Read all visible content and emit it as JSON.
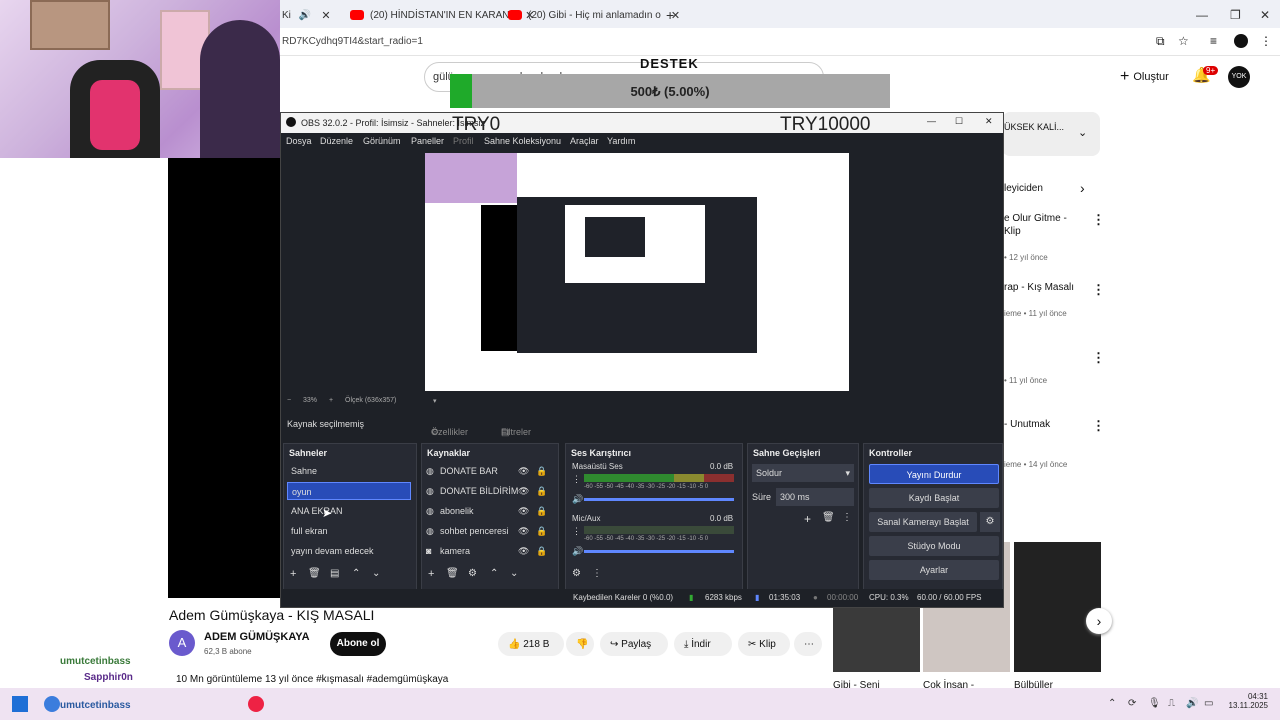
{
  "browser": {
    "tabs": [
      {
        "label": "Ki"
      },
      {
        "label": "(20) HİNDİSTAN'IN EN KARANL"
      },
      {
        "label": "(20) Gibi - Hiç mi anlamadın o"
      }
    ],
    "url": "RD7KCydhq9TI4&start_radio=1"
  },
  "youtube": {
    "search_value": "gülü ouyun ser askım bırakman",
    "create_label": "Oluştur",
    "notif_count": "9+",
    "avatar_text": "YOK",
    "chip_label": "ÜKSEK KALİ...",
    "related": [
      {
        "title": "leyiciden",
        "sub": ""
      },
      {
        "title": "e Olur Gitme -\nKlip",
        "sub": "• 12 yıl önce"
      },
      {
        "title": "rap - Kış Masalı",
        "sub": "ieme • 11 yıl önce"
      },
      {
        "title": "",
        "sub": "• 11 yıl önce"
      },
      {
        "title": "- Unutmak",
        "sub": "ieme • 14 yıl önce"
      }
    ],
    "shorts": [
      "Gibi - Seni",
      "Çok İnsan -",
      "Bülbüller"
    ],
    "video_title": "Adem Gümüşkaya - KIŞ MASALI",
    "channel_name": "ADEM GÜMÜŞKAYA",
    "channel_subs": "62,3 B abone",
    "channel_initial": "A",
    "subscribe_label": "Abone ol",
    "likes": "218 B",
    "share": "Paylaş",
    "download": "İndir",
    "clip": "Klip",
    "views_line": "10 Mn görüntüleme  13 yıl önce  #kışmasalı #ademgümüşkaya"
  },
  "overlay": {
    "destek": "DESTEK",
    "donate_amount": "500₺ (5.00%)",
    "donate_progress": 0.05,
    "min_label": "TRY0",
    "max_label": "TRY10000"
  },
  "chat": {
    "user1": "umutcetinbass",
    "user2": "Sapphir0n",
    "user3": "umutcetinbass"
  },
  "obs": {
    "title": "OBS 32.0.2 - Profil: İsimsiz - Sahneler: İsimsiz",
    "menu": [
      "Dosya",
      "Düzenle",
      "Görünüm",
      "Paneller",
      "Profil",
      "Sahne Koleksiyonu",
      "Araçlar",
      "Yardım"
    ],
    "zoom": "33%",
    "scale": "Ölçek (636x357)",
    "source_status": "Kaynak seçilmemiş",
    "properties": "Özellikler",
    "filters": "Filtreler",
    "scenes_title": "Sahneler",
    "scenes": [
      "Sahne",
      "oyun",
      "ANA EKRAN",
      "full ekran",
      "yayın devam edecek"
    ],
    "sources_title": "Kaynaklar",
    "sources": [
      "DONATE BAR",
      "DONATE BİLDİRİM",
      "abonelik",
      "sohbet penceresi",
      "kamera"
    ],
    "mixer_title": "Ses Karıştırıcı",
    "mixer": [
      {
        "name": "Masaüstü Ses",
        "db": "0.0 dB"
      },
      {
        "name": "Mic/Aux",
        "db": "0.0 dB"
      }
    ],
    "meter_ticks": "-60 -55 -50 -45 -40 -35 -30 -25 -20 -15 -10 -5 0",
    "transitions_title": "Sahne Geçişleri",
    "transition": "Soldur",
    "duration_label": "Süre",
    "duration": "300 ms",
    "controls_title": "Kontroller",
    "controls": [
      "Yayını Durdur",
      "Kaydı Başlat",
      "Sanal Kamerayı Başlat",
      "Stüdyo Modu",
      "Ayarlar"
    ],
    "status": {
      "dropped": "Kaybedilen Kareler 0 (%0.0)",
      "bitrate": "6283 kbps",
      "live_time": "01:35:03",
      "rec_time": "00:00:00",
      "cpu": "CPU: 0.3%",
      "fps": "60.00 / 60.00 FPS"
    }
  },
  "taskbar": {
    "time": "04:31",
    "date": "13.11.2025"
  }
}
